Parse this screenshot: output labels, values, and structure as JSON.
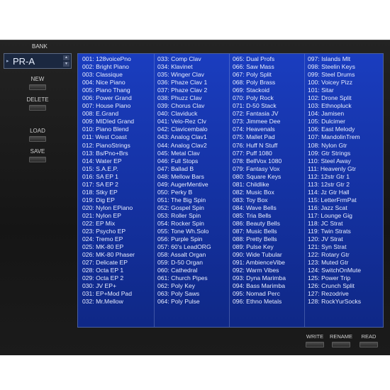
{
  "bank": {
    "label": "BANK",
    "value": "PR-A"
  },
  "side_buttons": {
    "new": "NEW",
    "delete": "DELETE",
    "load": "LOAD",
    "save": "SAVE"
  },
  "bottom_buttons": {
    "write": "WRITE",
    "rename": "RENAME",
    "read": "READ"
  },
  "patches": [
    [
      "001: 128voicePno",
      "002: Bright Piano",
      "003: Classique",
      "004: Nice Piano",
      "005: Piano Thang",
      "006: Power Grand",
      "007: House Piano",
      "008: E.Grand",
      "009: MIDIed Grand",
      "010: Piano Blend",
      "011: West Coast",
      "012: PianoStrings",
      "013: Bs/Pno+Brs",
      "014: Water EP",
      "015: S.A.E.P.",
      "016: SA EP 1",
      "017: SA EP 2",
      "018: Stky EP",
      "019: Dig EP",
      "020: Nylon EPiano",
      "021: Nylon EP",
      "022: EP Mix",
      "023: Psycho EP",
      "024: Tremo EP",
      "025: MK-80 EP",
      "026: MK-80 Phaser",
      "027: Delicate EP",
      "028: Octa EP 1",
      "029: Octa EP 2",
      "030: JV EP+",
      "031: EP+Mod Pad",
      "032: Mr.Mellow"
    ],
    [
      "033: Comp Clav",
      "034: Klavinet",
      "035: Winger Clav",
      "036: Phaze Clav 1",
      "037: Phaze Clav 2",
      "038: Phuzz Clav",
      "039: Chorus Clav",
      "040: Claviduck",
      "041: Velo-Rez Clv",
      "042: Clavicembalo",
      "043: Analog Clav1",
      "044: Analog Clav2",
      "045: Metal Clav",
      "046: Full Stops",
      "047: Ballad B",
      "048: Mellow Bars",
      "049: AugerMentive",
      "050: Perky B",
      "051: The Big Spin",
      "052: Gospel Spin",
      "053: Roller Spin",
      "054: Rocker Spin",
      "055: Tone Wh.Solo",
      "056: Purple Spin",
      "057: 60's LeadORG",
      "058: Assalt Organ",
      "059: D-50 Organ",
      "060: Cathedral",
      "061: Church Pipes",
      "062: Poly Key",
      "063: Poly Saws",
      "064: Poly Pulse"
    ],
    [
      "065: Dual Profs",
      "066: Saw Mass",
      "067: Poly Split",
      "068: Poly Brass",
      "069: Stackoid",
      "070: Poly Rock",
      "071: D-50 Stack",
      "072: Fantasia JV",
      "073: Jimmee Dee",
      "074: Heavenals",
      "075: Mallet Pad",
      "076: Huff N Stuff",
      "077: Puff 1080",
      "078: BellVox 1080",
      "079: Fantasy Vox",
      "080: Square Keys",
      "081: Childlike",
      "082: Music Box",
      "083: Toy Box",
      "084: Wave Bells",
      "085: Tria Bells",
      "086: Beauty Bells",
      "087: Music Bells",
      "088: Pretty Bells",
      "089: Pulse Key",
      "090: Wide Tubular",
      "091: AmbienceVibe",
      "092: Warm Vibes",
      "093: Dyna Marimba",
      "094: Bass Marimba",
      "095: Nomad Perc",
      "096: Ethno Metals"
    ],
    [
      "097: Islands Mlt",
      "098: Steelin Keys",
      "099: Steel Drums",
      "100: Voicey Pizz",
      "101: Sitar",
      "102: Drone Split",
      "103: Ethnopluck",
      "104: Jamisen",
      "105: Dulcimer",
      "106: East Melody",
      "107: MandolinTrem",
      "108: Nylon Gtr",
      "109: Gtr Strings",
      "110: Steel Away",
      "111: Heavenly Gtr",
      "112: 12str Gtr 1",
      "113: 12str Gtr 2",
      "114: Jz Gtr Hall",
      "115: LetterFrmPat",
      "116: Jazz Scat",
      "117: Lounge Gig",
      "118: JC Strat",
      "119: Twin Strats",
      "120: JV Strat",
      "121: Syn Strat",
      "122: Rotary Gtr",
      "123: Muted Gtr",
      "124: SwitchOnMute",
      "125: Power Trip",
      "126: Crunch Split",
      "127: Rezodrive",
      "128: RockYurSocks"
    ]
  ]
}
